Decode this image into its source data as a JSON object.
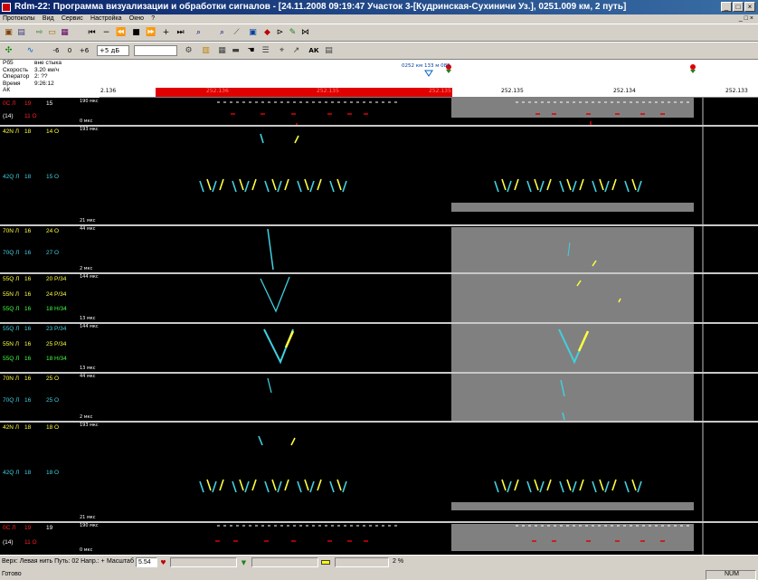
{
  "window": {
    "title": "Rdm-22: Программа визуализации и обработки сигналов - [24.11.2008 09:19:47 Участок 3-[Кудринская-Сухиничи Уз.], 0251.009 км, 2 путь]",
    "min": "_",
    "max": "□",
    "close": "×"
  },
  "menu": {
    "items": [
      "Протоколы",
      "Вид",
      "Сервис",
      "Настройка",
      "Окно",
      "?"
    ],
    "mdi": "_ □ ×"
  },
  "toolbar2": {
    "btn_m6": "-6",
    "btn_0": "0",
    "btn_p6": "+6",
    "gain_combo": "+5 дБ",
    "mode_combo": "",
    "ak_label": "АК"
  },
  "info": {
    "rows": [
      {
        "k": "Рб5",
        "v": "вне стыка"
      },
      {
        "k": "Скорость",
        "v": "3.20 км/ч"
      },
      {
        "k": "Оператор",
        "v": "2: ??"
      },
      {
        "k": "Время",
        "v": "9:26:12"
      },
      {
        "k": "АК",
        "v": ""
      }
    ]
  },
  "ruler": {
    "marker_text": "0252 км 133 м 085",
    "ticks": [
      "2.136",
      "252.136",
      "252.135",
      "252.135",
      "252.135",
      "252.134",
      "252.133"
    ]
  },
  "channels": [
    {
      "lines": [
        {
          "t": "0С Л",
          "c": "#ff2020"
        },
        {
          "t": "19",
          "c": "#ff2020"
        },
        {
          "t": "15",
          "c": "#ffffff"
        },
        {
          "t": "(14)",
          "c": "#ffffff"
        },
        {
          "t": "11 О",
          "c": "#ff2020"
        }
      ],
      "scale_top": "190 мкс",
      "scale_bot": "0 мкс"
    },
    {
      "lines": [
        {
          "t": "42N Л",
          "c": "#ffff40"
        },
        {
          "t": "18",
          "c": "#ffff40"
        },
        {
          "t": "14 О",
          "c": "#ffff40"
        },
        {
          "t": "42Q Л",
          "c": "#40d0e0"
        },
        {
          "t": "18",
          "c": "#40d0e0"
        },
        {
          "t": "15 О",
          "c": "#40d0e0"
        }
      ],
      "scale_top": "193 мкс",
      "scale_bot": "21 мкс"
    },
    {
      "lines": [
        {
          "t": "70N Л",
          "c": "#ffff40"
        },
        {
          "t": "16",
          "c": "#ffff40"
        },
        {
          "t": "24 О",
          "c": "#ffff40"
        },
        {
          "t": "70Q Л",
          "c": "#40d0e0"
        },
        {
          "t": "16",
          "c": "#40d0e0"
        },
        {
          "t": "27 О",
          "c": "#40d0e0"
        }
      ],
      "scale_top": "44 мкс",
      "scale_bot": "2 мкс"
    },
    {
      "lines": [
        {
          "t": "55Q Л",
          "c": "#ffff40"
        },
        {
          "t": "16",
          "c": "#ffff40"
        },
        {
          "t": "20 Р/34",
          "c": "#ffff40"
        },
        {
          "t": "55N Л",
          "c": "#ffff40"
        },
        {
          "t": "16",
          "c": "#ffff40"
        },
        {
          "t": "24 Р/34",
          "c": "#ffff40"
        },
        {
          "t": "55Q Л",
          "c": "#40ff40"
        },
        {
          "t": "16",
          "c": "#40ff40"
        },
        {
          "t": "18 Н/34",
          "c": "#40ff40"
        }
      ],
      "scale_top": "144 мкс",
      "scale_bot": "13 мкс"
    },
    {
      "lines": [
        {
          "t": "55Q Л",
          "c": "#40d0e0"
        },
        {
          "t": "16",
          "c": "#40d0e0"
        },
        {
          "t": "23 Р/34",
          "c": "#40d0e0"
        },
        {
          "t": "55N Л",
          "c": "#ffff40"
        },
        {
          "t": "16",
          "c": "#ffff40"
        },
        {
          "t": "25 Р/34",
          "c": "#ffff40"
        },
        {
          "t": "55Q Л",
          "c": "#40ff40"
        },
        {
          "t": "16",
          "c": "#40ff40"
        },
        {
          "t": "18 Н/34",
          "c": "#40ff40"
        }
      ],
      "scale_top": "144 мкс",
      "scale_bot": "13 мкс"
    },
    {
      "lines": [
        {
          "t": "70N Л",
          "c": "#ffff40"
        },
        {
          "t": "16",
          "c": "#ffff40"
        },
        {
          "t": "25 О",
          "c": "#ffff40"
        },
        {
          "t": "70Q Л",
          "c": "#40d0e0"
        },
        {
          "t": "16",
          "c": "#40d0e0"
        },
        {
          "t": "25 О",
          "c": "#40d0e0"
        }
      ],
      "scale_top": "44 мкс",
      "scale_bot": "2 мкс"
    },
    {
      "lines": [
        {
          "t": "42N Л",
          "c": "#ffff40"
        },
        {
          "t": "18",
          "c": "#ffff40"
        },
        {
          "t": "18 О",
          "c": "#ffff40"
        },
        {
          "t": "42Q Л",
          "c": "#40d0e0"
        },
        {
          "t": "18",
          "c": "#40d0e0"
        },
        {
          "t": "18 О",
          "c": "#40d0e0"
        }
      ],
      "scale_top": "193 мкс",
      "scale_bot": "21 мкс"
    },
    {
      "lines": [
        {
          "t": "0С Л",
          "c": "#ff2020"
        },
        {
          "t": "19",
          "c": "#ff2020"
        },
        {
          "t": "19",
          "c": "#ffffff"
        },
        {
          "t": "(14)",
          "c": "#ffffff"
        },
        {
          "t": "11 О",
          "c": "#ff2020"
        }
      ],
      "scale_top": "190 мкс",
      "scale_bot": "0 мкс"
    }
  ],
  "status": {
    "thread": "Верх: Левая нить Путь: 02 Напр.: +",
    "scale_label": "Масштаб",
    "scale_value": "5.54",
    "percent": "2 %",
    "ready": "Готово",
    "num": "NUM"
  },
  "colors": {
    "yellow": "#ffff40",
    "cyan": "#40d0e0",
    "red": "#e00000",
    "gray_band": "#808080"
  }
}
